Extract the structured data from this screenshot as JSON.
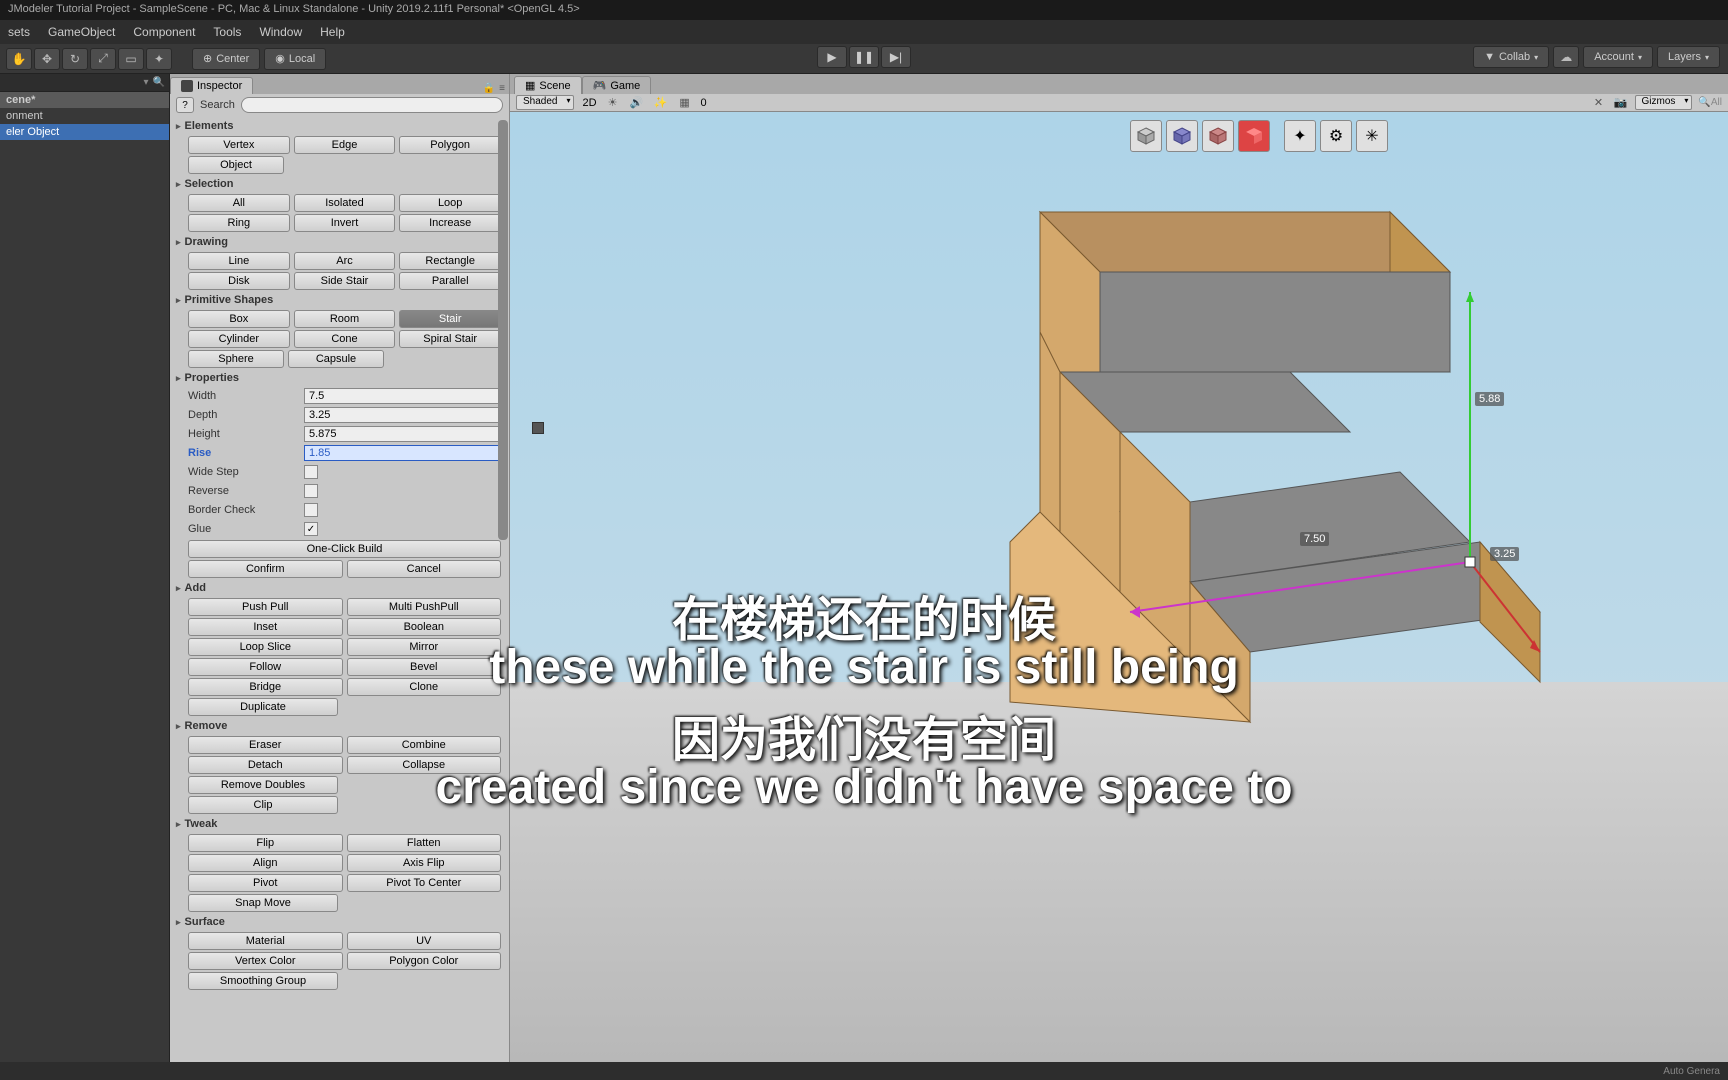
{
  "titlebar": "JModeler Tutorial Project - SampleScene - PC, Mac & Linux Standalone - Unity 2019.2.11f1 Personal* <OpenGL 4.5>",
  "menubar": [
    "sets",
    "GameObject",
    "Component",
    "Tools",
    "Window",
    "Help"
  ],
  "toolbar": {
    "center": "Center",
    "local": "Local"
  },
  "play": {
    "play": "▶",
    "pause": "❚❚",
    "step": "▶|"
  },
  "right_tools": {
    "collab": "Collab",
    "account": "Account",
    "layers": "Layers"
  },
  "hierarchy": {
    "scene": "cene*",
    "items": [
      "onment",
      "eler Object"
    ]
  },
  "inspector": {
    "tab": "Inspector",
    "help": "?",
    "search_label": "Search",
    "sections": {
      "elements": "Elements",
      "selection": "Selection",
      "drawing": "Drawing",
      "primitives": "Primitive Shapes",
      "properties": "Properties",
      "add": "Add",
      "remove": "Remove",
      "tweak": "Tweak",
      "surface": "Surface"
    },
    "elements_btns": [
      "Vertex",
      "Edge",
      "Polygon",
      "Object"
    ],
    "selection_btns": [
      "All",
      "Isolated",
      "Loop",
      "Ring",
      "Invert",
      "Increase"
    ],
    "drawing_btns": [
      "Line",
      "Arc",
      "Rectangle",
      "Disk",
      "Side Stair",
      "Parallel"
    ],
    "primitive_btns": [
      "Box",
      "Room",
      "Stair",
      "Cylinder",
      "Cone",
      "Spiral Stair",
      "Sphere",
      "Capsule"
    ],
    "props": {
      "width_l": "Width",
      "width_v": "7.5",
      "depth_l": "Depth",
      "depth_v": "3.25",
      "height_l": "Height",
      "height_v": "5.875",
      "rise_l": "Rise",
      "rise_v": "1.85",
      "widestep_l": "Wide Step",
      "reverse_l": "Reverse",
      "border_l": "Border Check",
      "glue_l": "Glue",
      "oneclick": "One-Click Build",
      "confirm": "Confirm",
      "cancel": "Cancel"
    },
    "add_btns": [
      "Push Pull",
      "Multi PushPull",
      "Inset",
      "Boolean",
      "Loop Slice",
      "Mirror",
      "Follow",
      "Bevel",
      "Bridge",
      "Clone",
      "Duplicate"
    ],
    "remove_btns": [
      "Eraser",
      "Combine",
      "Detach",
      "Collapse",
      "Remove Doubles",
      "",
      "Clip"
    ],
    "tweak_btns": [
      "Flip",
      "Flatten",
      "Align",
      "Axis Flip",
      "Pivot",
      "Pivot To Center",
      "Snap Move"
    ],
    "surface_btns": [
      "Material",
      "UV",
      "Vertex Color",
      "Polygon Color",
      "Smoothing Group"
    ]
  },
  "scene_view": {
    "scene_tab": "Scene",
    "game_tab": "Game",
    "shading": "Shaded",
    "mode_2d": "2D",
    "zero": "0",
    "gizmos": "Gizmos",
    "all": "All"
  },
  "dims": {
    "y": "5.88",
    "x": "7.50",
    "z": "3.25"
  },
  "subtitles": {
    "cn1": "在楼梯还在的时候",
    "en1": "these while the stair is still being",
    "cn2": "因为我们没有空间",
    "en2": "created since we didn't have space to"
  },
  "status": "Auto Genera",
  "colors": {
    "accent": "#3d6fb3",
    "highlight": "#2a5cc4"
  }
}
